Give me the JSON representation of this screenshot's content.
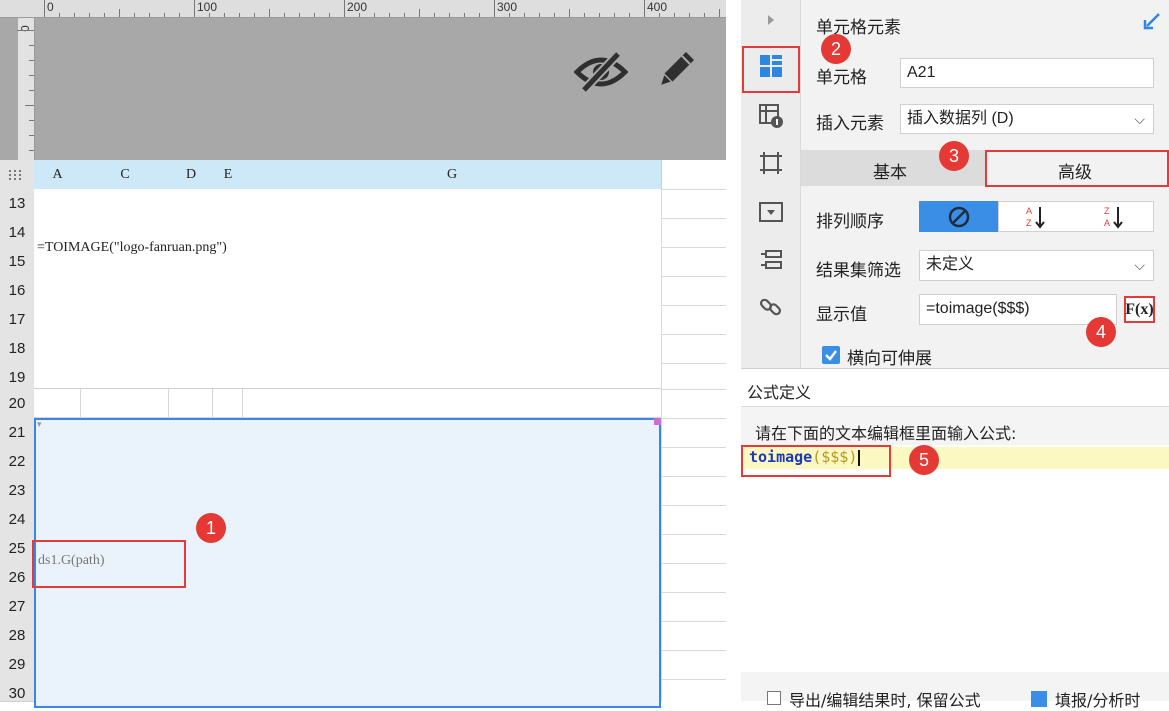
{
  "ruler": {
    "labels": [
      "0",
      "100",
      "200",
      "300",
      "400"
    ]
  },
  "ruler_left": {
    "label": "0"
  },
  "canvas": {
    "hide_icon": "eye-slash-icon",
    "edit_icon": "pencil-icon"
  },
  "sheet": {
    "corner_icon": "grid-dots-icon",
    "columns": [
      "A",
      "C",
      "D",
      "E",
      "G"
    ],
    "rows": [
      "13",
      "14",
      "15",
      "16",
      "17",
      "18",
      "19",
      "20",
      "21",
      "22",
      "23",
      "24",
      "25",
      "26",
      "27",
      "28",
      "29",
      "30"
    ],
    "formula_cell": "=TOIMAGE(\"logo-fanruan.png\")",
    "data_cell": "ds1.G(path)"
  },
  "callouts": [
    "1",
    "2",
    "3",
    "4",
    "5"
  ],
  "panel": {
    "title": "单元格元素",
    "cell_label": "单元格",
    "cell_value": "A21",
    "insert_label": "插入元素",
    "insert_value": "插入数据列 (D)",
    "tab_basic": "基本",
    "tab_advanced": "高级",
    "sort_label": "排列顺序",
    "filter_label": "结果集筛选",
    "filter_value": "未定义",
    "display_label": "显示值",
    "display_value": "=toimage($$$)",
    "fx_label": "F(x)",
    "expand_label": "横向可伸展",
    "accent": "#3a8ee6"
  },
  "formula": {
    "title": "公式定义",
    "instruction": "请在下面的文本编辑框里面输入公式:",
    "func_name": "toimage",
    "func_args": "($$$)",
    "bottom_left": "导出/编辑结果时, 保留公式",
    "bottom_right": "填报/分析时"
  }
}
